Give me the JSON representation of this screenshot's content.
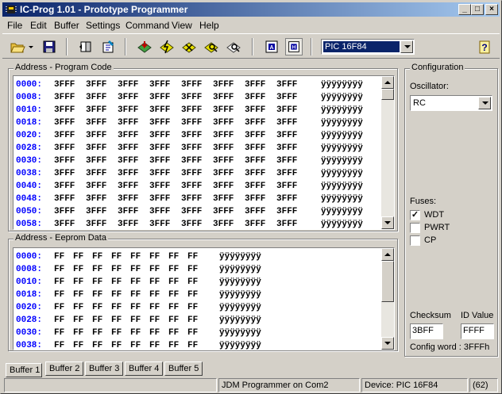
{
  "window": {
    "title": "IC-Prog 1.01 - Prototype Programmer"
  },
  "menu": [
    {
      "label": "File"
    },
    {
      "label": "Edit"
    },
    {
      "label": "Buffer"
    },
    {
      "label": "Settings"
    },
    {
      "label": "Command"
    },
    {
      "label": "View"
    },
    {
      "label": "Help"
    }
  ],
  "toolbar": {
    "device": "PIC 16F84"
  },
  "program": {
    "label": "Address - Program Code",
    "rows": [
      {
        "addr": "0000:",
        "cells": [
          "3FFF",
          "3FFF",
          "3FFF",
          "3FFF",
          "3FFF",
          "3FFF",
          "3FFF",
          "3FFF"
        ],
        "ascii": "ÿÿÿÿÿÿÿÿ"
      },
      {
        "addr": "0008:",
        "cells": [
          "3FFF",
          "3FFF",
          "3FFF",
          "3FFF",
          "3FFF",
          "3FFF",
          "3FFF",
          "3FFF"
        ],
        "ascii": "ÿÿÿÿÿÿÿÿ"
      },
      {
        "addr": "0010:",
        "cells": [
          "3FFF",
          "3FFF",
          "3FFF",
          "3FFF",
          "3FFF",
          "3FFF",
          "3FFF",
          "3FFF"
        ],
        "ascii": "ÿÿÿÿÿÿÿÿ"
      },
      {
        "addr": "0018:",
        "cells": [
          "3FFF",
          "3FFF",
          "3FFF",
          "3FFF",
          "3FFF",
          "3FFF",
          "3FFF",
          "3FFF"
        ],
        "ascii": "ÿÿÿÿÿÿÿÿ"
      },
      {
        "addr": "0020:",
        "cells": [
          "3FFF",
          "3FFF",
          "3FFF",
          "3FFF",
          "3FFF",
          "3FFF",
          "3FFF",
          "3FFF"
        ],
        "ascii": "ÿÿÿÿÿÿÿÿ"
      },
      {
        "addr": "0028:",
        "cells": [
          "3FFF",
          "3FFF",
          "3FFF",
          "3FFF",
          "3FFF",
          "3FFF",
          "3FFF",
          "3FFF"
        ],
        "ascii": "ÿÿÿÿÿÿÿÿ"
      },
      {
        "addr": "0030:",
        "cells": [
          "3FFF",
          "3FFF",
          "3FFF",
          "3FFF",
          "3FFF",
          "3FFF",
          "3FFF",
          "3FFF"
        ],
        "ascii": "ÿÿÿÿÿÿÿÿ"
      },
      {
        "addr": "0038:",
        "cells": [
          "3FFF",
          "3FFF",
          "3FFF",
          "3FFF",
          "3FFF",
          "3FFF",
          "3FFF",
          "3FFF"
        ],
        "ascii": "ÿÿÿÿÿÿÿÿ"
      },
      {
        "addr": "0040:",
        "cells": [
          "3FFF",
          "3FFF",
          "3FFF",
          "3FFF",
          "3FFF",
          "3FFF",
          "3FFF",
          "3FFF"
        ],
        "ascii": "ÿÿÿÿÿÿÿÿ"
      },
      {
        "addr": "0048:",
        "cells": [
          "3FFF",
          "3FFF",
          "3FFF",
          "3FFF",
          "3FFF",
          "3FFF",
          "3FFF",
          "3FFF"
        ],
        "ascii": "ÿÿÿÿÿÿÿÿ"
      },
      {
        "addr": "0050:",
        "cells": [
          "3FFF",
          "3FFF",
          "3FFF",
          "3FFF",
          "3FFF",
          "3FFF",
          "3FFF",
          "3FFF"
        ],
        "ascii": "ÿÿÿÿÿÿÿÿ"
      },
      {
        "addr": "0058:",
        "cells": [
          "3FFF",
          "3FFF",
          "3FFF",
          "3FFF",
          "3FFF",
          "3FFF",
          "3FFF",
          "3FFF"
        ],
        "ascii": "ÿÿÿÿÿÿÿÿ"
      }
    ]
  },
  "eeprom": {
    "label": "Address - Eeprom Data",
    "rows": [
      {
        "addr": "0000:",
        "cells": [
          "FF",
          "FF",
          "FF",
          "FF",
          "FF",
          "FF",
          "FF",
          "FF"
        ],
        "ascii": "ÿÿÿÿÿÿÿÿ"
      },
      {
        "addr": "0008:",
        "cells": [
          "FF",
          "FF",
          "FF",
          "FF",
          "FF",
          "FF",
          "FF",
          "FF"
        ],
        "ascii": "ÿÿÿÿÿÿÿÿ"
      },
      {
        "addr": "0010:",
        "cells": [
          "FF",
          "FF",
          "FF",
          "FF",
          "FF",
          "FF",
          "FF",
          "FF"
        ],
        "ascii": "ÿÿÿÿÿÿÿÿ"
      },
      {
        "addr": "0018:",
        "cells": [
          "FF",
          "FF",
          "FF",
          "FF",
          "FF",
          "FF",
          "FF",
          "FF"
        ],
        "ascii": "ÿÿÿÿÿÿÿÿ"
      },
      {
        "addr": "0020:",
        "cells": [
          "FF",
          "FF",
          "FF",
          "FF",
          "FF",
          "FF",
          "FF",
          "FF"
        ],
        "ascii": "ÿÿÿÿÿÿÿÿ"
      },
      {
        "addr": "0028:",
        "cells": [
          "FF",
          "FF",
          "FF",
          "FF",
          "FF",
          "FF",
          "FF",
          "FF"
        ],
        "ascii": "ÿÿÿÿÿÿÿÿ"
      },
      {
        "addr": "0030:",
        "cells": [
          "FF",
          "FF",
          "FF",
          "FF",
          "FF",
          "FF",
          "FF",
          "FF"
        ],
        "ascii": "ÿÿÿÿÿÿÿÿ"
      },
      {
        "addr": "0038:",
        "cells": [
          "FF",
          "FF",
          "FF",
          "FF",
          "FF",
          "FF",
          "FF",
          "FF"
        ],
        "ascii": "ÿÿÿÿÿÿÿÿ"
      }
    ]
  },
  "config": {
    "label": "Configuration",
    "oscillator_label": "Oscillator:",
    "oscillator": "RC",
    "fuses_label": "Fuses:",
    "fuses": [
      {
        "label": "WDT",
        "checked": true,
        "mark": "✓"
      },
      {
        "label": "PWRT",
        "checked": false,
        "mark": ""
      },
      {
        "label": "CP",
        "checked": false,
        "mark": ""
      }
    ],
    "checksum_label": "Checksum",
    "checksum": "3BFF",
    "id_label": "ID Value",
    "id_value": "FFFF",
    "config_word": "Config word : 3FFFh"
  },
  "tabs": [
    {
      "label": "Buffer 1"
    },
    {
      "label": "Buffer 2"
    },
    {
      "label": "Buffer 3"
    },
    {
      "label": "Buffer 4"
    },
    {
      "label": "Buffer 5"
    }
  ],
  "status": {
    "programmer": "JDM Programmer on Com2",
    "device": "Device: PIC 16F84",
    "count": "(62)"
  }
}
